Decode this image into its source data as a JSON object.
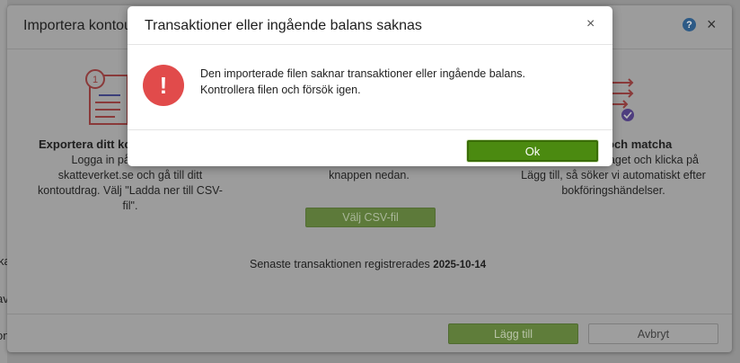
{
  "background": {
    "labels": [
      "ka",
      "av",
      "on"
    ]
  },
  "import_dialog": {
    "title": "Importera kontou",
    "help_glyph": "?",
    "close_glyph": "×",
    "steps": [
      {
        "step_number": "1",
        "title": "Exportera ditt kont",
        "text_lines": [
          "Logga in på ditt",
          "skatteverket.se och gå till ditt",
          "kontoutdrag. Välj \"Ladda ner till CSV-",
          "fil\"."
        ]
      },
      {
        "text_lines": [
          "knappen nedan."
        ]
      },
      {
        "title": "och matcha",
        "text_lines": [
          "raget och klicka på",
          "Lägg till, så söker vi automatiskt efter",
          "bokföringshändelser."
        ]
      }
    ],
    "csv_button": "Välj CSV-fil",
    "latest_label": "Senaste transaktionen registrerades",
    "latest_date": "2025-10-14",
    "add_button": "Lägg till",
    "cancel_button": "Avbryt"
  },
  "alert": {
    "title": "Transaktioner eller ingående balans saknas",
    "close_glyph": "×",
    "icon_glyph": "!",
    "message_line1": "Den importerade filen saknar transaktioner eller ingående balans.",
    "message_line2": "Kontrollera filen och försök igen.",
    "ok_button": "Ok"
  },
  "colors": {
    "accent_green": "#4b8a10",
    "error_red": "#e14b4b"
  }
}
